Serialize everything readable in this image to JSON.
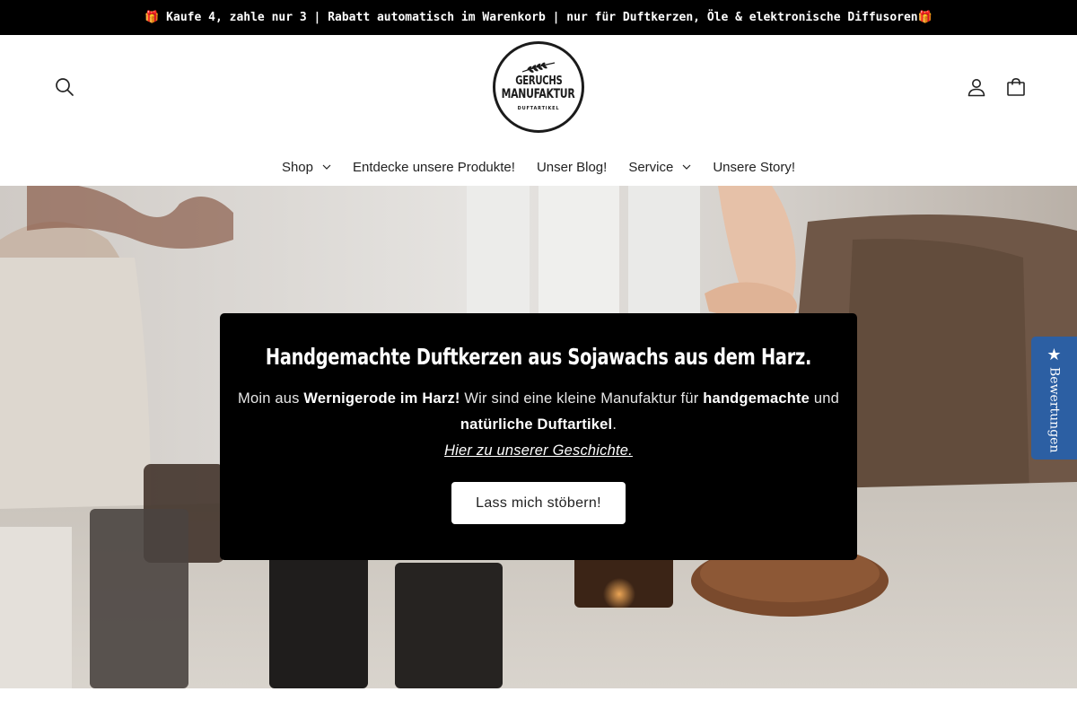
{
  "announcement": {
    "text": "🎁 Kaufe 4, zahle nur 3 | Rabatt automatisch im Warenkorb | nur für Duftkerzen, Öle & elektronische Diffusoren🎁"
  },
  "logo": {
    "line1": "GERUCHS",
    "line2": "MANUFAKTUR",
    "subline": "DUFTARTIKEL"
  },
  "icons": {
    "search": "search-icon",
    "account": "account-icon",
    "cart": "cart-icon"
  },
  "nav": {
    "items": [
      {
        "label": "Shop",
        "dropdown": true
      },
      {
        "label": "Entdecke unsere Produkte!",
        "dropdown": false
      },
      {
        "label": "Unser Blog!",
        "dropdown": false
      },
      {
        "label": "Service",
        "dropdown": true
      },
      {
        "label": "Unsere Story!",
        "dropdown": false
      }
    ]
  },
  "hero": {
    "title": "Handgemachte Duftkerzen aus Sojawachs aus dem Harz.",
    "text_intro": "Moin aus ",
    "text_bold1": "Wernigerode im Harz!",
    "text_mid": " Wir sind eine kleine Manufaktur für ",
    "text_bold2": "handgemachte",
    "text_and": " und",
    "text_bold3": "natürliche Duftartikel",
    "text_end": ".",
    "link": "Hier zu unserer Geschichte.",
    "button": "Lass mich stöbern!"
  },
  "reviews_tab": {
    "label": "Bewertungen",
    "icon": "star-icon"
  },
  "colors": {
    "announcement_bg": "#000000",
    "card_bg": "#000000",
    "reviews_tab": "#2c5fa3"
  }
}
